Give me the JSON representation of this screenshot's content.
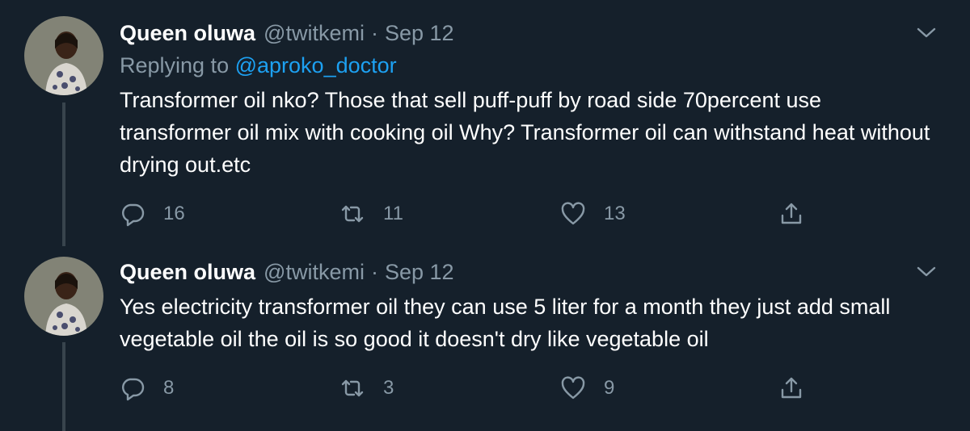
{
  "colors": {
    "background": "#15202b",
    "text_primary": "#ffffff",
    "text_secondary": "#8899a6",
    "link": "#1da1f2",
    "thread_line": "#38444d"
  },
  "tweets": [
    {
      "display_name": "Queen oluwa",
      "handle": "@twitkemi",
      "separator": "·",
      "date": "Sep 12",
      "replying_prefix": "Replying to",
      "replying_to": "@aproko_doctor",
      "text": "Transformer oil nko? Those that sell puff-puff by road side 70percent use transformer oil mix with cooking oil Why? Transformer oil can withstand heat without drying out.etc",
      "replies": "16",
      "retweets": "11",
      "likes": "13",
      "icons": {
        "reply": "reply-icon",
        "retweet": "retweet-icon",
        "like": "heart-icon",
        "share": "share-icon",
        "menu": "chevron-down-icon"
      }
    },
    {
      "display_name": "Queen oluwa",
      "handle": "@twitkemi",
      "separator": "·",
      "date": "Sep 12",
      "text": "Yes electricity transformer oil they can use 5 liter for a month they just add small vegetable oil the oil is so good it doesn't dry like vegetable oil",
      "replies": "8",
      "retweets": "3",
      "likes": "9",
      "icons": {
        "reply": "reply-icon",
        "retweet": "retweet-icon",
        "like": "heart-icon",
        "share": "share-icon",
        "menu": "chevron-down-icon"
      }
    }
  ]
}
